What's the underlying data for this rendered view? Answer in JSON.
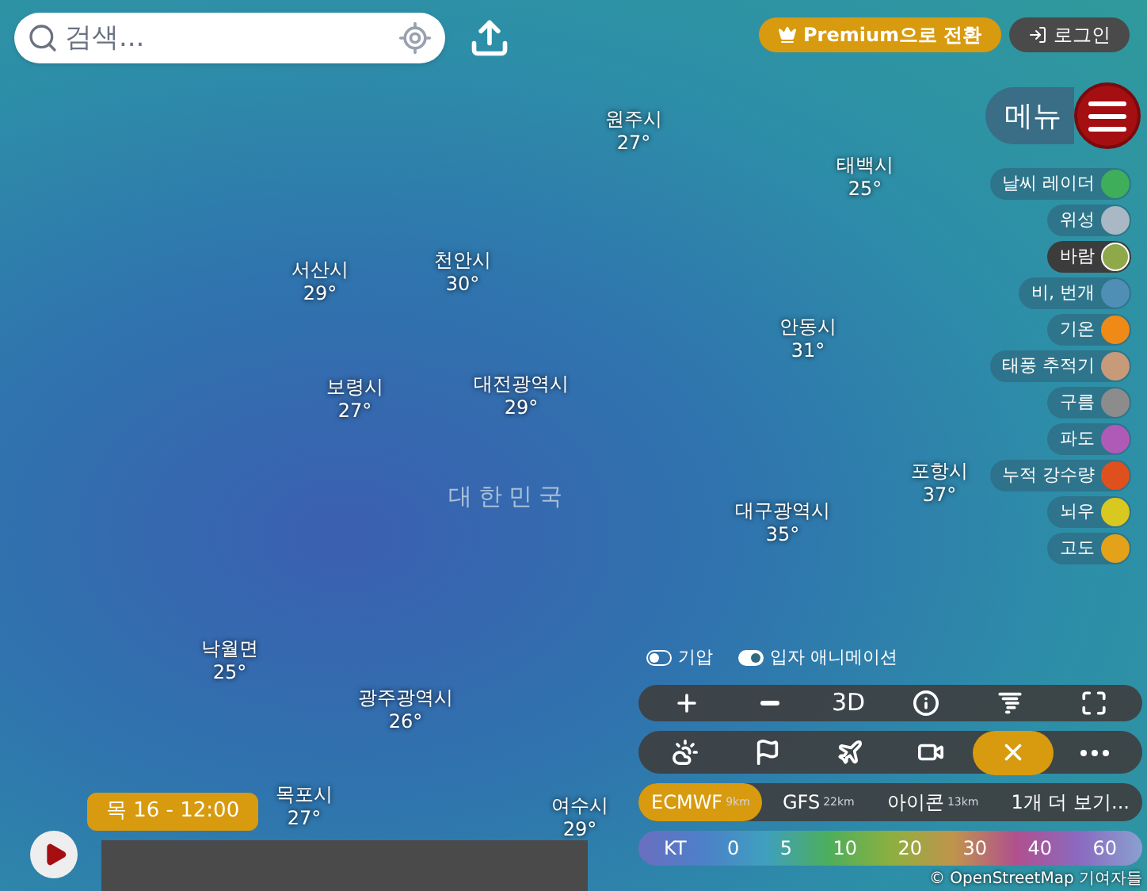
{
  "search": {
    "placeholder": "검색..."
  },
  "header": {
    "premium": "Premium으로 전환",
    "login": "로그인",
    "menu": "메뉴"
  },
  "cities": [
    {
      "name": "원주시",
      "temp": "27°"
    },
    {
      "name": "태백시",
      "temp": "25°"
    },
    {
      "name": "서산시",
      "temp": "29°"
    },
    {
      "name": "천안시",
      "temp": "30°"
    },
    {
      "name": "안동시",
      "temp": "31°"
    },
    {
      "name": "보령시",
      "temp": "27°"
    },
    {
      "name": "대전광역시",
      "temp": "29°"
    },
    {
      "name": "포항시",
      "temp": "37°"
    },
    {
      "name": "대구광역시",
      "temp": "35°"
    },
    {
      "name": "낙월면",
      "temp": "25°"
    },
    {
      "name": "광주광역시",
      "temp": "26°"
    },
    {
      "name": "목포시",
      "temp": "27°"
    },
    {
      "name": "여수시",
      "temp": "29°"
    }
  ],
  "country": {
    "name": "대한민국"
  },
  "layers": [
    {
      "label": "날씨 레이더",
      "selected": false,
      "color": "#3fae5a"
    },
    {
      "label": "위성",
      "selected": false,
      "color": "#a9b8c4"
    },
    {
      "label": "바람",
      "selected": true,
      "color": "#8fa84a"
    },
    {
      "label": "비, 번개",
      "selected": false,
      "color": "#4f8fb5"
    },
    {
      "label": "기온",
      "selected": false,
      "color": "#f08a16"
    },
    {
      "label": "태풍 추적기",
      "selected": false,
      "color": "#c79a7a"
    },
    {
      "label": "구름",
      "selected": false,
      "color": "#8c8c8c"
    },
    {
      "label": "파도",
      "selected": false,
      "color": "#b05ab8"
    },
    {
      "label": "누적 강수량",
      "selected": false,
      "color": "#e0501e"
    },
    {
      "label": "뇌우",
      "selected": false,
      "color": "#d8c820"
    },
    {
      "label": "고도",
      "selected": false,
      "color": "#e3a21a"
    }
  ],
  "toggles": [
    {
      "label": "기압",
      "on": false
    },
    {
      "label": "입자 애니메이션",
      "on": true
    }
  ],
  "toolbar_1": [
    {
      "kind": "plus"
    },
    {
      "kind": "minus"
    },
    {
      "kind": "text",
      "label": "3D"
    },
    {
      "kind": "info"
    },
    {
      "kind": "storm"
    },
    {
      "kind": "fullscreen"
    }
  ],
  "toolbar_2": [
    {
      "kind": "weather",
      "selected": false
    },
    {
      "kind": "flag",
      "selected": false
    },
    {
      "kind": "plane",
      "selected": false
    },
    {
      "kind": "camera",
      "selected": false
    },
    {
      "kind": "close",
      "selected": true
    },
    {
      "kind": "more",
      "selected": false
    }
  ],
  "models": [
    {
      "name": "ECMWF",
      "resolution": "9km",
      "selected": true
    },
    {
      "name": "GFS",
      "resolution": "22km",
      "selected": false
    },
    {
      "name": "아이콘",
      "resolution": "13km",
      "selected": false
    },
    {
      "name": "1개 더 보기...",
      "selected": false
    }
  ],
  "legend": {
    "unit": "KT",
    "ticks": [
      "0",
      "5",
      "10",
      "20",
      "30",
      "40",
      "60"
    ]
  },
  "timeline": {
    "time": "목 16 - 12:00"
  },
  "attribution": "© OpenStreetMap 기여자들"
}
